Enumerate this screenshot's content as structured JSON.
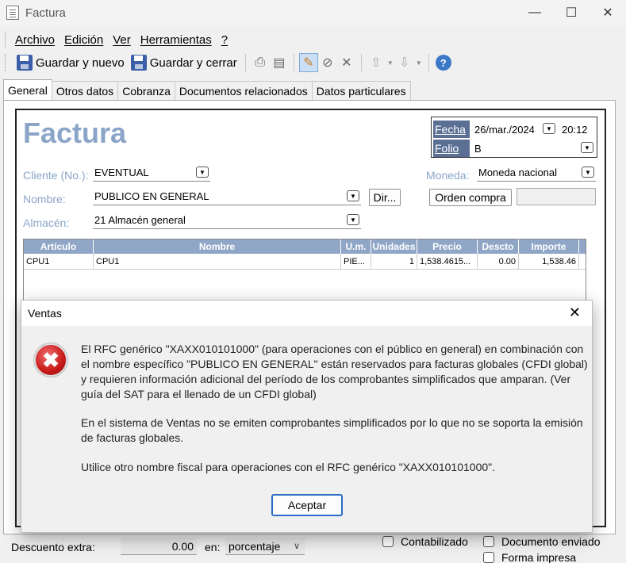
{
  "window": {
    "title": "Factura"
  },
  "menu": [
    "Archivo",
    "Edición",
    "Ver",
    "Herramientas",
    "?"
  ],
  "toolbar": {
    "save_new": "Guardar y nuevo",
    "save_close": "Guardar y cerrar"
  },
  "tabs": [
    "General",
    "Otros datos",
    "Cobranza",
    "Documentos relacionados",
    "Datos particulares"
  ],
  "form": {
    "heading": "Factura",
    "fecha_label": "Fecha",
    "fecha_value": "26/mar./2024",
    "hora_value": "20:12",
    "folio_label": "Folio",
    "folio_value": "B",
    "cliente_label": "Cliente (No.):",
    "cliente_value": "EVENTUAL",
    "nombre_label": "Nombre:",
    "nombre_value": "PUBLICO EN GENERAL",
    "dir_button": "Dir...",
    "almacen_label": "Almacén:",
    "almacen_value": "21 Almacén general",
    "moneda_label": "Moneda:",
    "moneda_value": "Moneda nacional",
    "orden_compra_button": "Orden compra",
    "orden_compra_value": ""
  },
  "grid": {
    "headers": [
      "Artículo",
      "Nombre",
      "U.m.",
      "Unidades",
      "Precio",
      "Descto",
      "Importe"
    ],
    "rows": [
      [
        "CPU1",
        "CPU1",
        "PIE...",
        "1",
        "1,538.4615...",
        "0.00",
        "1,538.46"
      ]
    ]
  },
  "bottom": {
    "descuento_label": "Descuento extra:",
    "descuento_value": "0.00",
    "en_label": "en:",
    "en_value": "porcentaje",
    "contabilizado": "Contabilizado",
    "doc_enviado": "Documento enviado",
    "forma_impresa": "Forma impresa"
  },
  "dialog": {
    "title": "Ventas",
    "para1": "El RFC genérico \"XAXX010101000\" (para operaciones con el público en general) en combinación con el nombre específico \"PUBLICO EN GENERAL\" están reservados para facturas globales (CFDI global) y requieren información adicional del período de los comprobantes simplificados que amparan. (Ver guía del SAT para el llenado de un CFDI global)",
    "para2": "En el sistema de Ventas no se emiten comprobantes simplificados por lo que no se soporta la emisión de facturas globales.",
    "para3": "Utilice otro nombre fiscal para operaciones con el RFC genérico \"XAXX010101000\".",
    "button": "Aceptar"
  }
}
